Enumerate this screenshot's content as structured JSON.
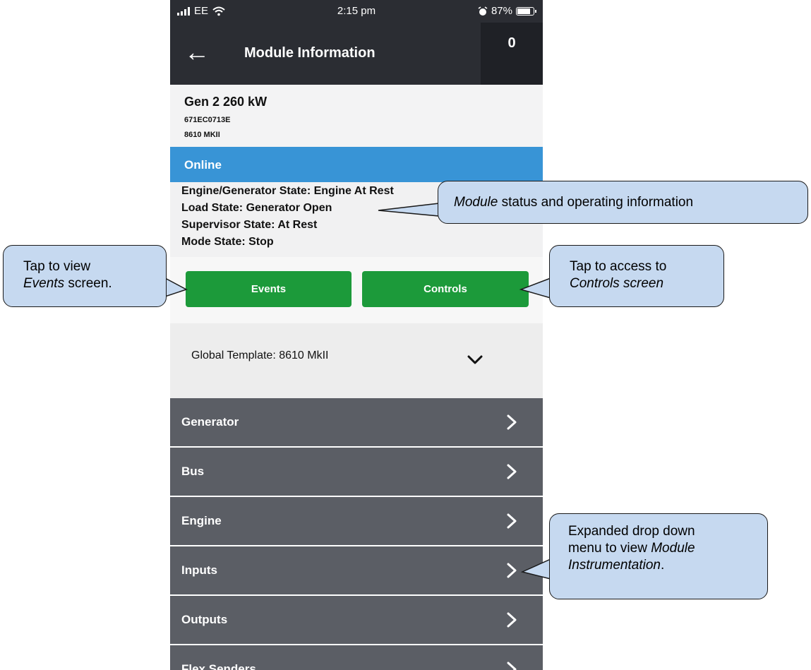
{
  "status_bar": {
    "carrier": "EE",
    "time": "2:15 pm",
    "battery_percent": "87%",
    "battery_level": 0.87,
    "icons": [
      "signal-icon",
      "wifi-icon",
      "alarm-icon",
      "battery-icon"
    ]
  },
  "header": {
    "back_icon": "←",
    "title": "Module Information",
    "counter": "0"
  },
  "module": {
    "name": "Gen 2 260 kW",
    "serial": "671EC0713E",
    "model": "8610 MKII"
  },
  "connection": {
    "status": "Online"
  },
  "states": {
    "engine_generator": "Engine/Generator State: Engine At Rest",
    "load": "Load State: Generator Open",
    "supervisor": "Supervisor State: At Rest",
    "mode": "Mode State: Stop"
  },
  "buttons": {
    "events": "Events",
    "controls": "Controls"
  },
  "template": {
    "label": "Global Template: 8610 MkII"
  },
  "menu": {
    "items": [
      {
        "label": "Generator"
      },
      {
        "label": "Bus"
      },
      {
        "label": "Engine"
      },
      {
        "label": "Inputs"
      },
      {
        "label": "Outputs"
      },
      {
        "label": "Flex Senders"
      }
    ]
  },
  "callouts": {
    "status": {
      "italic": "Module",
      "rest": " status and operating information"
    },
    "events": {
      "line1": "Tap to view",
      "line2_italic": "Events",
      "line2_rest": " screen."
    },
    "controls": {
      "line1": "Tap to access to",
      "line2_italic": "Controls screen"
    },
    "menu": {
      "line1": "Expanded drop down",
      "line2_a": "menu to view ",
      "line2_italic": "Module",
      "line3_italic": "Instrumentation",
      "line3_rest": "."
    }
  },
  "colors": {
    "header": "#2b2d33",
    "online": "#3894d6",
    "button_green": "#1c9a3a",
    "menu_item": "#5b5e65",
    "callout_fill": "#c6d9f0"
  }
}
